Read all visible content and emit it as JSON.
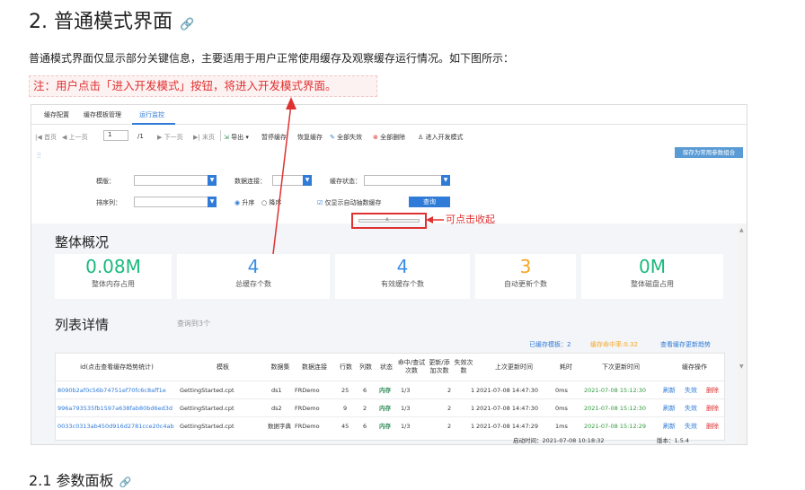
{
  "heading": {
    "title": "2. 普通模式界面",
    "link_icon": "link-icon"
  },
  "intro": "普通模式界面仅显示部分关键信息，主要适用于用户正常使用缓存及观察缓存运行情况。如下图所示：",
  "note": "注：用户点击「进入开发模式」按钮，将进入开发模式界面。",
  "tabs": [
    "缓存配置",
    "缓存模板管理",
    "运行监控"
  ],
  "toolbar": {
    "first": "首页",
    "prev": "上一页",
    "page_value": "1",
    "total": "/1",
    "next": "下一页",
    "last": "末页",
    "export": "导出",
    "pause": "暂停缓存",
    "resume": "恢复缓存",
    "fail_all": "全部失效",
    "delete_all": "全部删除",
    "dev_mode": "进入开发模式"
  },
  "save_button": "保存为常用参数组合",
  "filters": {
    "template_label": "模版：",
    "conn_label": "数据连接：",
    "status_label": "缓存状态：",
    "sort_label": "排序列：",
    "asc": "升序",
    "desc": "降序",
    "auto_only": "仅显示自动抽数缓存",
    "query": "查询"
  },
  "collapse_note": "可点击收起",
  "overview": {
    "title": "整体概况",
    "cards": [
      {
        "value": "0.08M",
        "label": "整体内存占用",
        "color": "#1bb97f"
      },
      {
        "value": "4",
        "label": "总缓存个数",
        "color": "#3a8ee6"
      },
      {
        "value": "4",
        "label": "有效缓存个数",
        "color": "#3a8ee6"
      },
      {
        "value": "3",
        "label": "自动更新个数",
        "color": "#f5a623"
      },
      {
        "value": "0M",
        "label": "整体磁盘占用",
        "color": "#1bb97f"
      }
    ]
  },
  "list": {
    "title": "列表详情",
    "subtitle": "查询到3个",
    "legend": {
      "used": "已缓存模板：2",
      "hit": "缓存命中率:0.32",
      "trend": "查看缓存更新趋势"
    },
    "headers": [
      "id(点击查看缓存趋势统计)",
      "模板",
      "数据集",
      "数据连接",
      "行数",
      "列数",
      "状态",
      "命中/查试次数",
      "更新/添加次数",
      "失效次数",
      "上次更新时间",
      "耗时",
      "下次更新时间",
      "缓存操作"
    ],
    "rows": [
      {
        "id": "8090b2af0c56b74751ef70fc6c8aff1e",
        "tpl": "GettingStarted.cpt",
        "ds": "ds1",
        "conn": "FRDemo",
        "rows": "25",
        "cols": "6",
        "status": "内存",
        "hit": "1/3",
        "upd": "2",
        "fail": "1",
        "last": "2021-07-08 14:47:30",
        "cost": "0ms",
        "next": "2021-07-08 15:12:30"
      },
      {
        "id": "996a793535fb1597a638fab80bd6ed3d",
        "tpl": "GettingStarted.cpt",
        "ds": "ds2",
        "conn": "FRDemo",
        "rows": "9",
        "cols": "2",
        "status": "内存",
        "hit": "1/3",
        "upd": "2",
        "fail": "1",
        "last": "2021-07-08 14:47:30",
        "cost": "0ms",
        "next": "2021-07-08 15:12:30"
      },
      {
        "id": "0033c0313ab450d916d2781cce20c4ab",
        "tpl": "GettingStarted.cpt",
        "ds": "数据字典",
        "conn": "FRDemo",
        "rows": "45",
        "cols": "6",
        "status": "内存",
        "hit": "1/3",
        "upd": "2",
        "fail": "1",
        "last": "2021-07-08 14:47:29",
        "cost": "1ms",
        "next": "2021-07-08 15:12:29"
      }
    ],
    "actions": {
      "refresh": "刷新",
      "fail": "失效",
      "delete": "删除"
    }
  },
  "footer": {
    "start": "启动时间：2021-07-08 10:18:32",
    "version": "版本：1.5.4"
  },
  "next_heading": "2.1 参数面板"
}
